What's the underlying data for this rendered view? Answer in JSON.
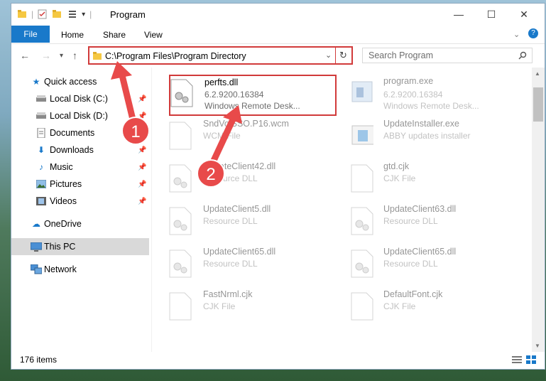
{
  "window": {
    "title": "Program",
    "controls": {
      "minimize": "—",
      "maximize": "☐",
      "close": "✕"
    }
  },
  "ribbon": {
    "tabs": [
      "File",
      "Home",
      "Share",
      "View"
    ],
    "help": "?"
  },
  "navigation": {
    "address": "C:\\Program Files\\Program Directory",
    "search_placeholder": "Search Program"
  },
  "sidebar": {
    "items": [
      {
        "label": "Quick access",
        "icon": "star-icon"
      },
      {
        "label": "Local Disk (C:)",
        "icon": "drive-icon",
        "pinned": true
      },
      {
        "label": "Local Disk (D:)",
        "icon": "drive-icon",
        "pinned": true
      },
      {
        "label": "Documents",
        "icon": "documents-icon",
        "pinned": true
      },
      {
        "label": "Downloads",
        "icon": "download-icon",
        "pinned": true
      },
      {
        "label": "Music",
        "icon": "music-icon",
        "pinned": true
      },
      {
        "label": "Pictures",
        "icon": "pictures-icon",
        "pinned": true
      },
      {
        "label": "Videos",
        "icon": "videos-icon",
        "pinned": true
      },
      {
        "label": "OneDrive",
        "icon": "cloud-icon"
      },
      {
        "label": "This PC",
        "icon": "computer-icon",
        "selected": true
      },
      {
        "label": "Network",
        "icon": "network-icon"
      }
    ]
  },
  "files": [
    {
      "name": "perfts.dll",
      "version": "6.2.9200.16384",
      "desc": "Windows Remote Desk...",
      "highlighted": true
    },
    {
      "name": "program.exe",
      "version": "6.2.9200.16384",
      "desc": "Windows Remote Desk..."
    },
    {
      "name": "SndVolSSO.P16.wcm",
      "desc": "WCM File"
    },
    {
      "name": "UpdateInstaller.exe",
      "desc": "ABBY updates installer"
    },
    {
      "name": "UpdateClient42.dll",
      "desc": "Resource DLL"
    },
    {
      "name": "gtd.cjk",
      "desc": "CJK File"
    },
    {
      "name": "UpdateClient5.dll",
      "desc": "Resource DLL"
    },
    {
      "name": "UpdateClient63.dll",
      "desc": "Resource DLL"
    },
    {
      "name": "UpdateClient65.dll",
      "desc": "Resource DLL"
    },
    {
      "name": "UpdateClient65.dll",
      "desc": "Resource DLL"
    },
    {
      "name": "FastNrml.cjk",
      "desc": "CJK File"
    },
    {
      "name": "DefaultFont.cjk",
      "desc": "CJK File"
    }
  ],
  "status": {
    "item_count": "176 items"
  },
  "annotations": [
    {
      "number": "1"
    },
    {
      "number": "2"
    }
  ],
  "colors": {
    "accent": "#1979ca",
    "highlight": "#d13a3a",
    "arrow": "#e84a4a"
  }
}
